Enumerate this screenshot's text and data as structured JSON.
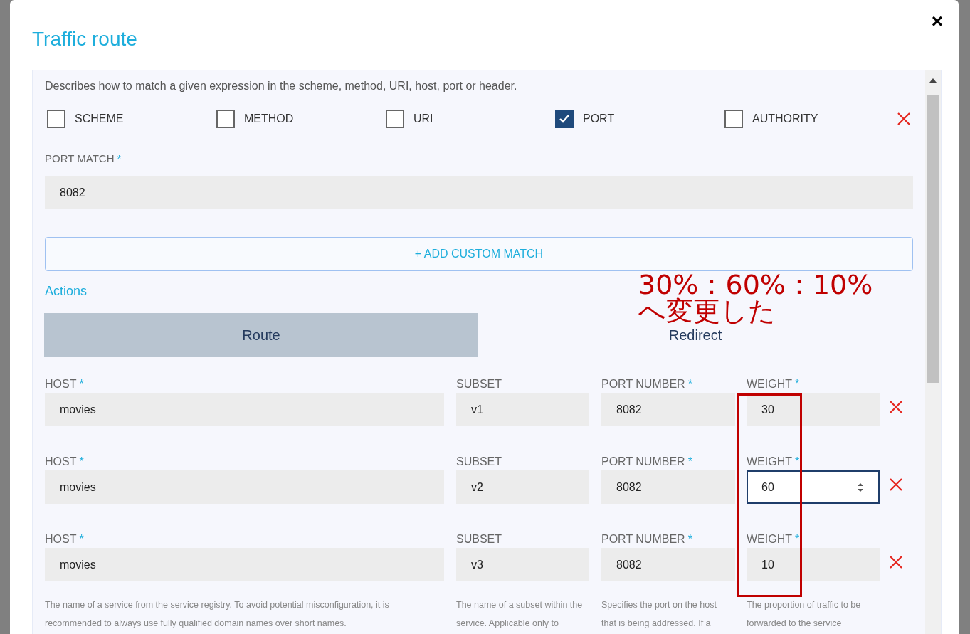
{
  "dialog": {
    "title": "Traffic route",
    "close": "×"
  },
  "match": {
    "description": "Describes how to match a given expression in the scheme, method, URI, host, port or header.",
    "options": [
      {
        "label": "SCHEME",
        "checked": false
      },
      {
        "label": "METHOD",
        "checked": false
      },
      {
        "label": "URI",
        "checked": false
      },
      {
        "label": "PORT",
        "checked": true
      },
      {
        "label": "AUTHORITY",
        "checked": false
      }
    ],
    "field": {
      "label": "PORT MATCH",
      "required_mark": "*",
      "value": "8082"
    },
    "add_button": "+ ADD CUSTOM MATCH"
  },
  "actions": {
    "title": "Actions",
    "tabs": [
      {
        "label": "Route",
        "selected": true
      },
      {
        "label": "Redirect",
        "selected": false
      }
    ]
  },
  "destinations": [
    {
      "fields": [
        {
          "label": "HOST",
          "required_mark": "*",
          "value": "movies",
          "focused": false
        },
        {
          "label": "SUBSET",
          "value": "v1",
          "focused": false
        },
        {
          "label": "PORT NUMBER",
          "required_mark": "*",
          "value": "8082",
          "focused": false
        },
        {
          "label": "WEIGHT",
          "required_mark": "*",
          "value": "30",
          "focused": false
        }
      ]
    },
    {
      "fields": [
        {
          "label": "HOST",
          "required_mark": "*",
          "value": "movies",
          "focused": false
        },
        {
          "label": "SUBSET",
          "value": "v2",
          "focused": false
        },
        {
          "label": "PORT NUMBER",
          "required_mark": "*",
          "value": "8082",
          "focused": false
        },
        {
          "label": "WEIGHT",
          "required_mark": "*",
          "value": "60",
          "focused": true
        }
      ]
    },
    {
      "fields": [
        {
          "label": "HOST",
          "required_mark": "*",
          "value": "movies",
          "focused": false
        },
        {
          "label": "SUBSET",
          "value": "v3",
          "focused": false
        },
        {
          "label": "PORT NUMBER",
          "required_mark": "*",
          "value": "8082",
          "focused": false
        },
        {
          "label": "WEIGHT",
          "required_mark": "*",
          "value": "10",
          "focused": false
        }
      ]
    }
  ],
  "help_texts": [
    "The name of a service from the service registry. To avoid potential misconfiguration, it is recommended to always use fully qualified domain names over short names.",
    "The name of a subset within the service. Applicable only to",
    "Specifies the port on the host that is being addressed. If a",
    "The proportion of traffic to be forwarded to the service"
  ],
  "annotation": {
    "lines": [
      "30%：60%：10%",
      "へ変更した"
    ]
  }
}
